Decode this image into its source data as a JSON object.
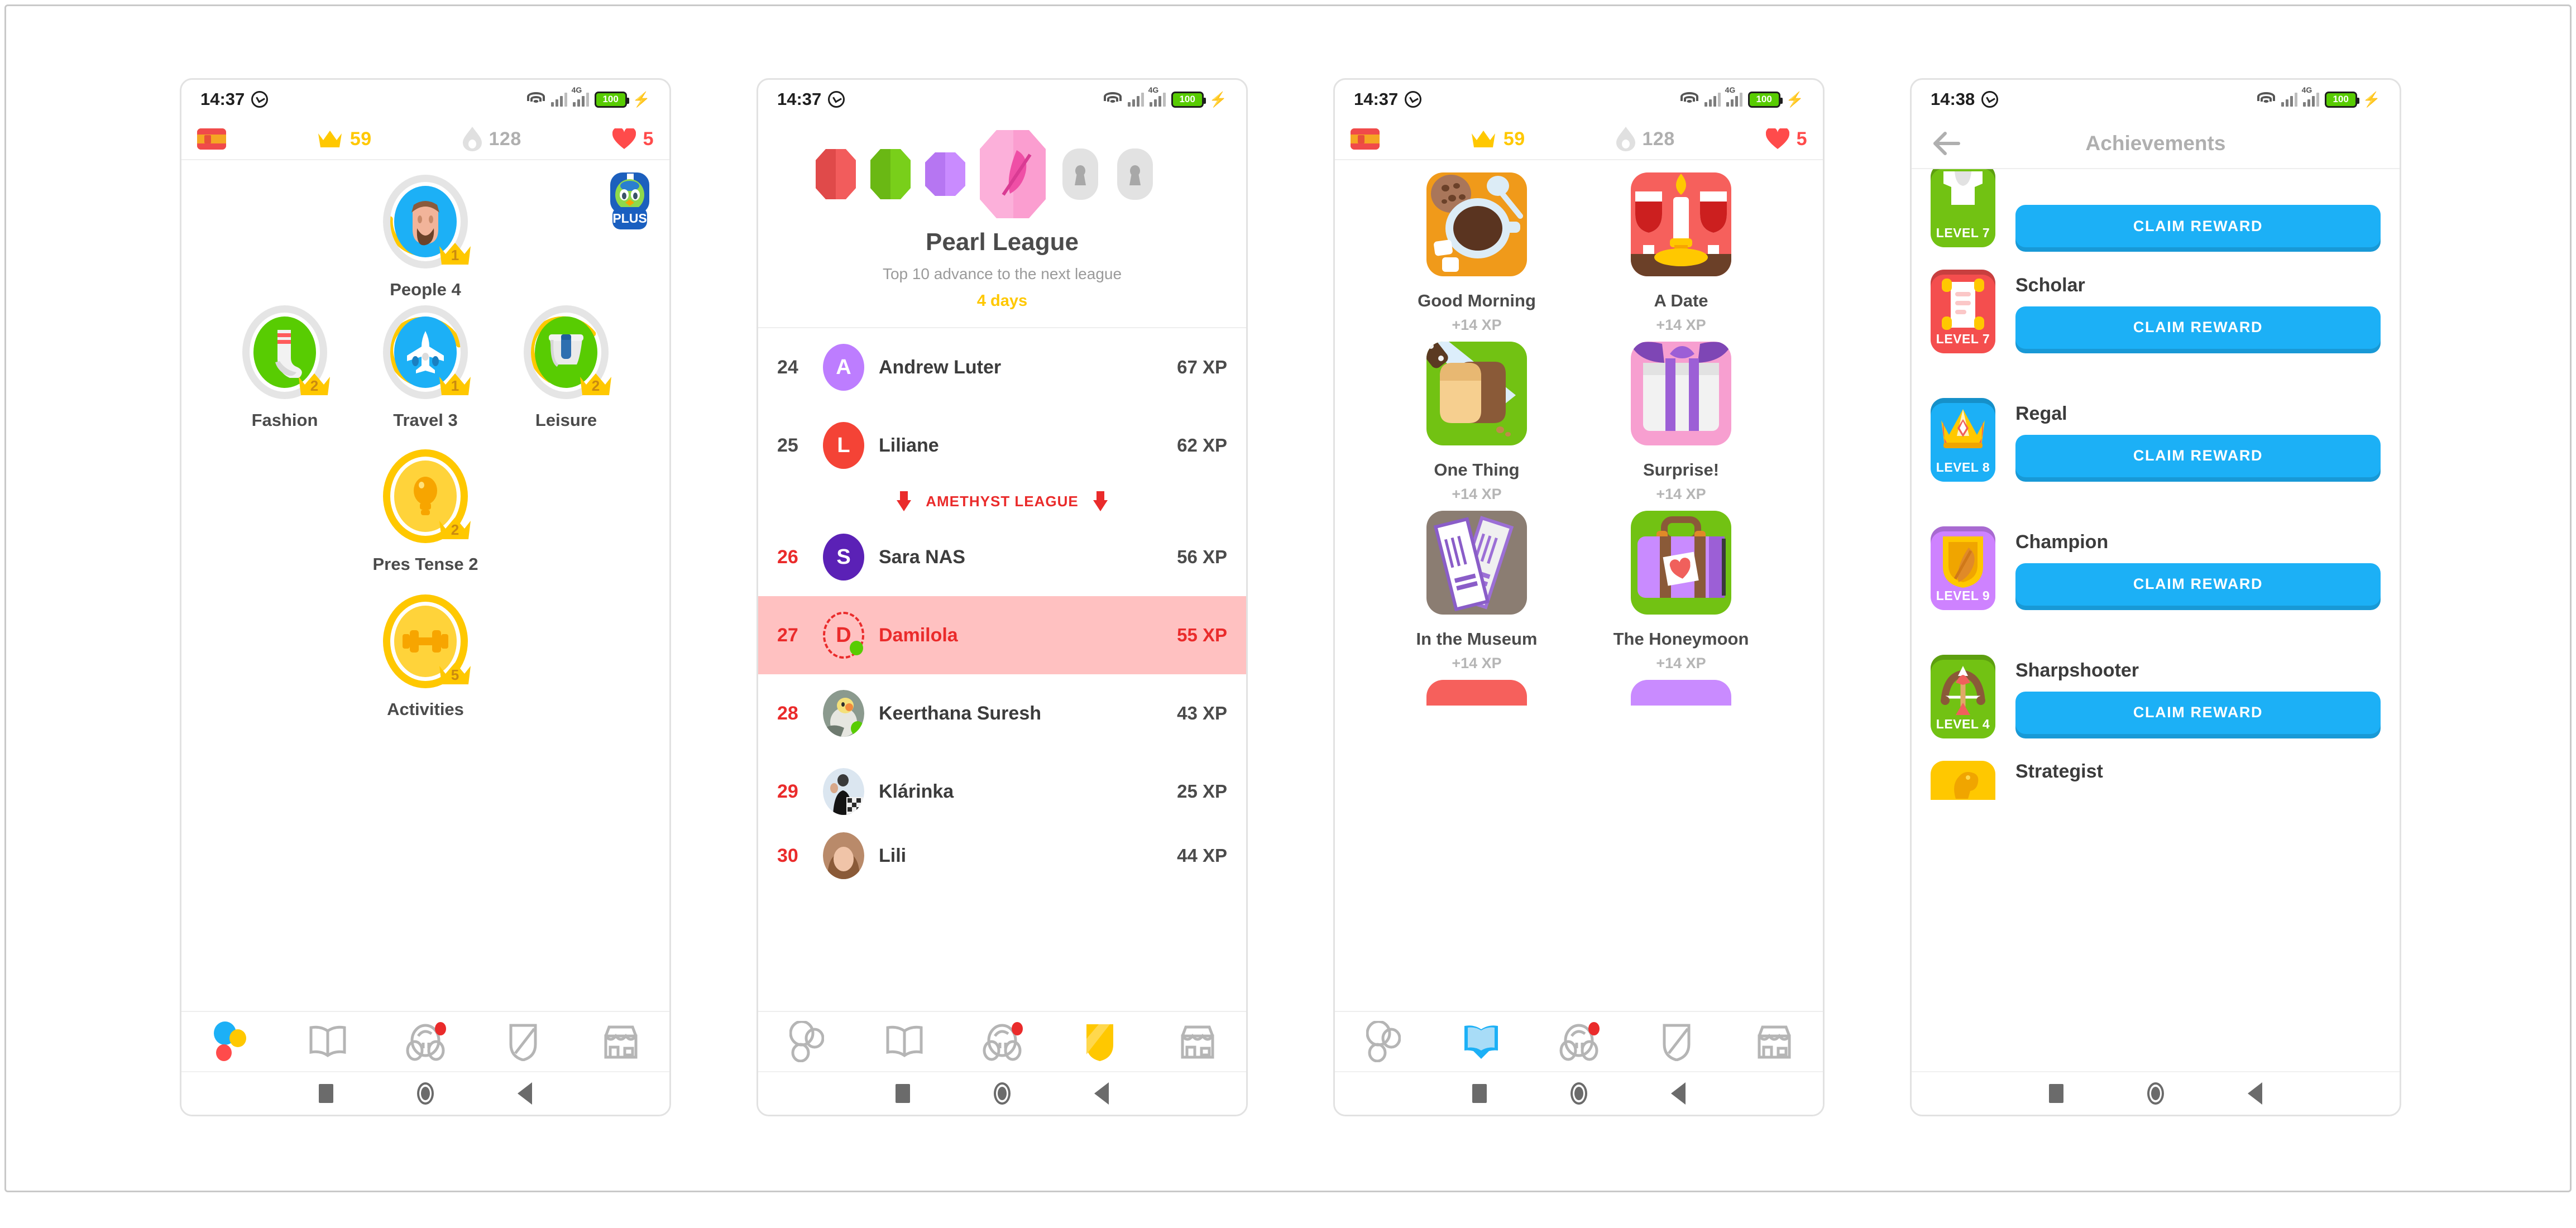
{
  "colors": {
    "duo_green": "#58cc02",
    "duo_blue": "#1cb0f6",
    "duo_yellow": "#ffc800",
    "duo_red": "#ea2b2b",
    "duo_purple": "#ce82ff",
    "text_dark": "#4b4b4b",
    "text_muted": "#afafaf"
  },
  "phone1": {
    "status": {
      "time": "14:37",
      "network": "4G",
      "battery": "100"
    },
    "stats": {
      "flag": "es-flag-icon",
      "crowns": "59",
      "streak": "128",
      "hearts": "5"
    },
    "plus_badge": "PLUS",
    "skills": [
      {
        "label": "People 4",
        "crown": "1",
        "color": "#1cb0f6",
        "ring": "partial",
        "icon": "person-icon"
      },
      {
        "label": "Fashion",
        "crown": "2",
        "color": "#58cc02",
        "ring": "empty",
        "icon": "sock-icon"
      },
      {
        "label": "Travel 3",
        "crown": "1",
        "color": "#1cb0f6",
        "ring": "partial",
        "icon": "airplane-icon"
      },
      {
        "label": "Leisure",
        "crown": "2",
        "color": "#58cc02",
        "ring": "partial",
        "icon": "bucket-icon"
      },
      {
        "label": "Pres Tense 2",
        "crown": "2",
        "color": "#ffc800",
        "ring": "gold",
        "icon": "lightbulb-icon"
      },
      {
        "label": "Activities",
        "crown": "5",
        "color": "#ffc800",
        "ring": "gold",
        "icon": "dumbbell-icon"
      }
    ],
    "nav": {
      "active": "learn",
      "items": [
        "learn-tab",
        "stories-tab",
        "profile-tab",
        "leagues-tab",
        "shop-tab"
      ]
    }
  },
  "phone2": {
    "status": {
      "time": "14:37",
      "network": "4G",
      "battery": "100"
    },
    "league": {
      "title": "Pearl League",
      "subtitle": "Top 10 advance to the next league",
      "countdown": "4 days",
      "gems": [
        "ruby-gem-icon",
        "emerald-gem-icon",
        "amethyst-gem-icon",
        "pearl-gem-icon",
        "locked-gem-icon",
        "locked-gem-icon"
      ],
      "current_gem_index": 3
    },
    "demotion_banner": "AMETHYST LEAGUE",
    "leaderboard": [
      {
        "rank": "24",
        "name": "Andrew Luter",
        "xp": "67 XP",
        "avatar_type": "initial",
        "initial": "A",
        "avatar_color": "#bd7dff",
        "rank_red": false,
        "me": false,
        "online": false
      },
      {
        "rank": "25",
        "name": "Liliane",
        "xp": "62 XP",
        "avatar_type": "initial",
        "initial": "L",
        "avatar_color": "#f44336",
        "rank_red": false,
        "me": false,
        "online": false
      },
      {
        "rank": "26",
        "name": "Sara NAS",
        "xp": "56 XP",
        "avatar_type": "initial",
        "initial": "S",
        "avatar_color": "#5b21b6",
        "rank_red": true,
        "me": false,
        "online": false
      },
      {
        "rank": "27",
        "name": "Damilola",
        "xp": "55 XP",
        "avatar_type": "dashed",
        "initial": "D",
        "avatar_color": "#ea2b2b",
        "rank_red": true,
        "me": true,
        "online": true
      },
      {
        "rank": "28",
        "name": "Keerthana Suresh",
        "xp": "43 XP",
        "avatar_type": "photo-bird",
        "initial": "",
        "avatar_color": "#9aa79c",
        "rank_red": true,
        "me": false,
        "online": true
      },
      {
        "rank": "29",
        "name": "Klárinka",
        "xp": "25 XP",
        "avatar_type": "photo-person",
        "initial": "",
        "avatar_color": "#d8e3ef",
        "rank_red": true,
        "me": false,
        "online": false
      },
      {
        "rank": "30",
        "name": "Lili",
        "xp": "44 XP",
        "avatar_type": "photo-woman",
        "initial": "",
        "avatar_color": "#c08a6a",
        "rank_red": true,
        "me": false,
        "online": false
      }
    ],
    "nav": {
      "active": "leagues",
      "items": [
        "learn-tab",
        "stories-tab",
        "profile-tab",
        "leagues-tab",
        "shop-tab"
      ]
    }
  },
  "phone3": {
    "status": {
      "time": "14:37",
      "network": "4G",
      "battery": "100"
    },
    "stats": {
      "flag": "es-flag-icon",
      "crowns": "59",
      "streak": "128",
      "hearts": "5"
    },
    "stories": [
      {
        "title": "Good Morning",
        "xp": "+14 XP",
        "art": "coffee-art",
        "bg": "#f09a1a"
      },
      {
        "title": "A Date",
        "xp": "+14 XP",
        "art": "candle-art",
        "bg": "#f6605c"
      },
      {
        "title": "One Thing",
        "xp": "+14 XP",
        "art": "toast-art",
        "bg": "#72c213"
      },
      {
        "title": "Surprise!",
        "xp": "+14 XP",
        "art": "gift-art",
        "bg": "#f79fd0"
      },
      {
        "title": "In the Museum",
        "xp": "+14 XP",
        "art": "tickets-art",
        "bg": "#8b7d72"
      },
      {
        "title": "The Honeymoon",
        "xp": "+14 XP",
        "art": "suitcase-art",
        "bg": "#72c213"
      }
    ],
    "nav": {
      "active": "stories",
      "items": [
        "learn-tab",
        "stories-tab",
        "profile-tab",
        "leagues-tab",
        "shop-tab"
      ]
    }
  },
  "phone4": {
    "status": {
      "time": "14:38",
      "network": "4G",
      "battery": "100"
    },
    "title": "Achievements",
    "back_icon": "back-arrow-icon",
    "achievements": [
      {
        "name": "",
        "level": "LEVEL 7",
        "button": "CLAIM REWARD",
        "badge_color": "#72c213",
        "glyph": "shirt-icon",
        "clipped": "top"
      },
      {
        "name": "Scholar",
        "level": "LEVEL 7",
        "button": "CLAIM REWARD",
        "badge_color": "#f44e4e",
        "glyph": "scroll-icon",
        "clipped": "none"
      },
      {
        "name": "Regal",
        "level": "LEVEL 8",
        "button": "CLAIM REWARD",
        "badge_color": "#1cb0f6",
        "glyph": "crown-icon",
        "clipped": "none"
      },
      {
        "name": "Champion",
        "level": "LEVEL 9",
        "button": "CLAIM REWARD",
        "badge_color": "#ce82ff",
        "glyph": "feather-shield-icon",
        "clipped": "none"
      },
      {
        "name": "Sharpshooter",
        "level": "LEVEL 4",
        "button": "CLAIM REWARD",
        "badge_color": "#72c213",
        "glyph": "bow-arrow-icon",
        "clipped": "none"
      },
      {
        "name": "Strategist",
        "level": "",
        "button": "",
        "badge_color": "#ffc800",
        "glyph": "chess-knight-icon",
        "clipped": "bottom"
      }
    ]
  }
}
